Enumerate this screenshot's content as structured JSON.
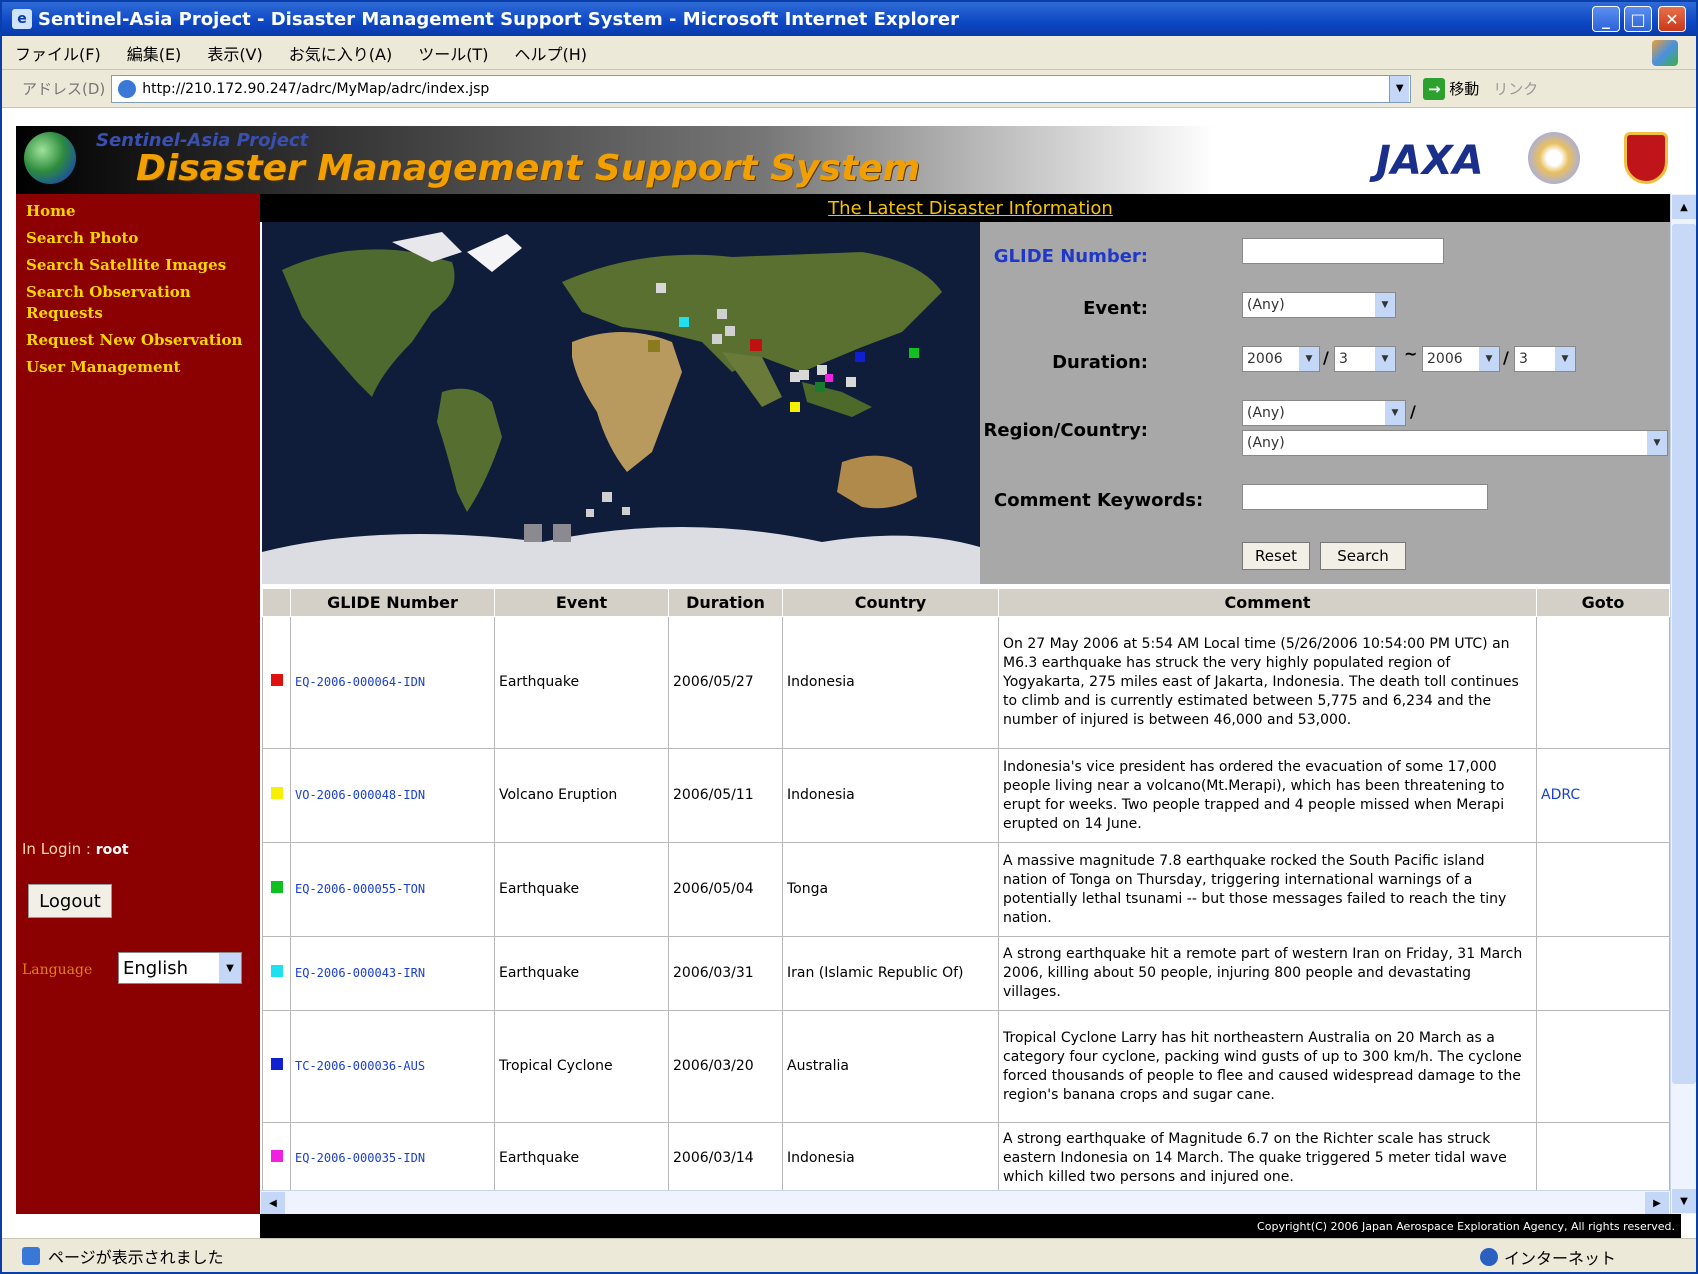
{
  "window": {
    "title": "Sentinel-Asia Project - Disaster Management Support System - Microsoft Internet Explorer"
  },
  "menu": [
    "ファイル(F)",
    "編集(E)",
    "表示(V)",
    "お気に入り(A)",
    "ツール(T)",
    "ヘルプ(H)"
  ],
  "address": {
    "label": "アドレス(D)",
    "url": "http://210.172.90.247/adrc/MyMap/adrc/index.jsp",
    "go_label": "移動",
    "links_label": "リンク"
  },
  "banner": {
    "project": "Sentinel-Asia Project",
    "title": "Disaster Management Support System",
    "jaxa": "JAXA"
  },
  "sidebar": {
    "items": [
      "Home",
      "Search Photo",
      "Search Satellite Images",
      "Search Observation Requests",
      "Request New Observation",
      "User Management"
    ],
    "login_label": "In Login : ",
    "login_user": "root",
    "logout_label": "Logout",
    "language_label": "Language",
    "language_value": "English"
  },
  "latest_link": "The Latest Disaster Information",
  "form": {
    "glide_label": "GLIDE Number:",
    "event_label": "Event:",
    "event_value": "(Any)",
    "duration_label": "Duration:",
    "duration_from_year": "2006",
    "duration_from_month": "3",
    "duration_to_year": "2006",
    "duration_to_month": "3",
    "duration_sep": "/",
    "duration_range": "~",
    "region_label": "Region/Country:",
    "region_value": "(Any)",
    "country_value": "(Any)",
    "region_sep": "/",
    "comment_label": "Comment Keywords:",
    "reset_label": "Reset",
    "search_label": "Search"
  },
  "table": {
    "headers": [
      "GLIDE Number",
      "Event",
      "Duration",
      "Country",
      "Comment",
      "Goto"
    ],
    "rows": [
      {
        "color": "#e01010",
        "glide": "EQ-2006-000064-IDN",
        "event": "Earthquake",
        "duration": "2006/05/27",
        "country": "Indonesia",
        "comment": "On 27 May 2006 at 5:54 AM Local time (5/26/2006 10:54:00 PM UTC) an M6.3 earthquake has struck the very highly populated region of Yogyakarta, 275 miles east of Jakarta, Indonesia. The death toll continues to climb and is currently estimated between 5,775 and 6,234 and the number of injured is between 46,000 and 53,000.",
        "goto": ""
      },
      {
        "color": "#f5f000",
        "glide": "VO-2006-000048-IDN",
        "event": "Volcano Eruption",
        "duration": "2006/05/11",
        "country": "Indonesia",
        "comment": "Indonesia's vice president has ordered the evacuation of some 17,000 people living near a volcano(Mt.Merapi), which has been threatening to erupt for weeks. Two people trapped and 4 people missed when Merapi erupted on 14 June.",
        "goto": "ADRC"
      },
      {
        "color": "#10c020",
        "glide": "EQ-2006-000055-TON",
        "event": "Earthquake",
        "duration": "2006/05/04",
        "country": "Tonga",
        "comment": "A massive magnitude 7.8 earthquake rocked the South Pacific island nation of Tonga on Thursday, triggering international warnings of a potentially lethal tsunami -- but those messages failed to reach the tiny nation.",
        "goto": ""
      },
      {
        "color": "#20e0f0",
        "glide": "EQ-2006-000043-IRN",
        "event": "Earthquake",
        "duration": "2006/03/31",
        "country": "Iran (Islamic Republic Of)",
        "comment": "A strong earthquake hit a remote part of western Iran on Friday, 31 March 2006, killing about 50 people, injuring 800 people and devastating villages.",
        "goto": ""
      },
      {
        "color": "#1020d0",
        "glide": "TC-2006-000036-AUS",
        "event": "Tropical Cyclone",
        "duration": "2006/03/20",
        "country": "Australia",
        "comment": "Tropical Cyclone Larry has hit northeastern Australia on 20 March as a category four cyclone, packing wind gusts of up to 300 km/h. The cyclone forced thousands of people to flee and caused widespread damage to the region's banana crops and sugar cane.",
        "goto": ""
      },
      {
        "color": "#f020e0",
        "glide": "EQ-2006-000035-IDN",
        "event": "Earthquake",
        "duration": "2006/03/14",
        "country": "Indonesia",
        "comment": "A strong earthquake of Magnitude 6.7 on the Richter scale has struck eastern Indonesia on 14 March. The quake triggered 5 meter tidal wave which killed two persons and injured one.",
        "goto": ""
      }
    ]
  },
  "footer": "Copyright(C) 2006 Japan Aerospace Exploration Agency, All rights reserved.",
  "status": {
    "text": "ページが表示されました",
    "zone": "インターネット"
  }
}
